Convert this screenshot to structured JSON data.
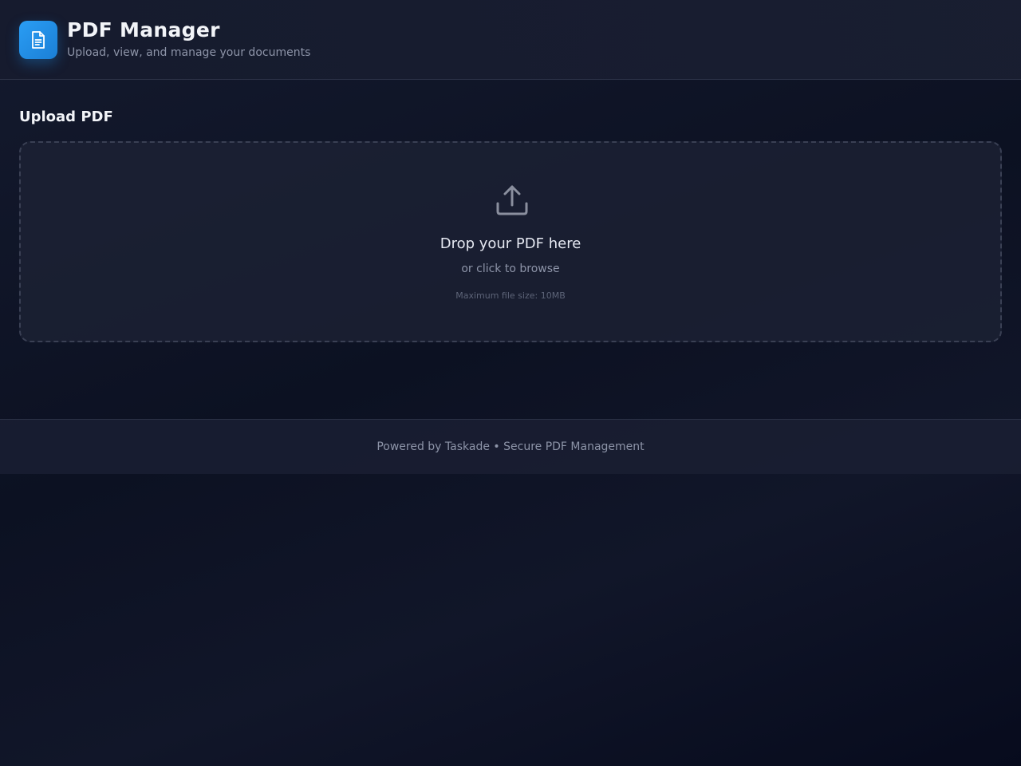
{
  "header": {
    "title": "PDF Manager",
    "subtitle": "Upload, view, and manage your documents",
    "icon": "document-icon",
    "accent_color": "#2196f3"
  },
  "upload": {
    "section_title": "Upload PDF",
    "dropzone": {
      "icon": "upload-icon",
      "title": "Drop your PDF here",
      "subtitle": "or click to browse",
      "note": "Maximum file size: 10MB"
    }
  },
  "footer": {
    "text": "Powered by Taskade • Secure PDF Management"
  }
}
